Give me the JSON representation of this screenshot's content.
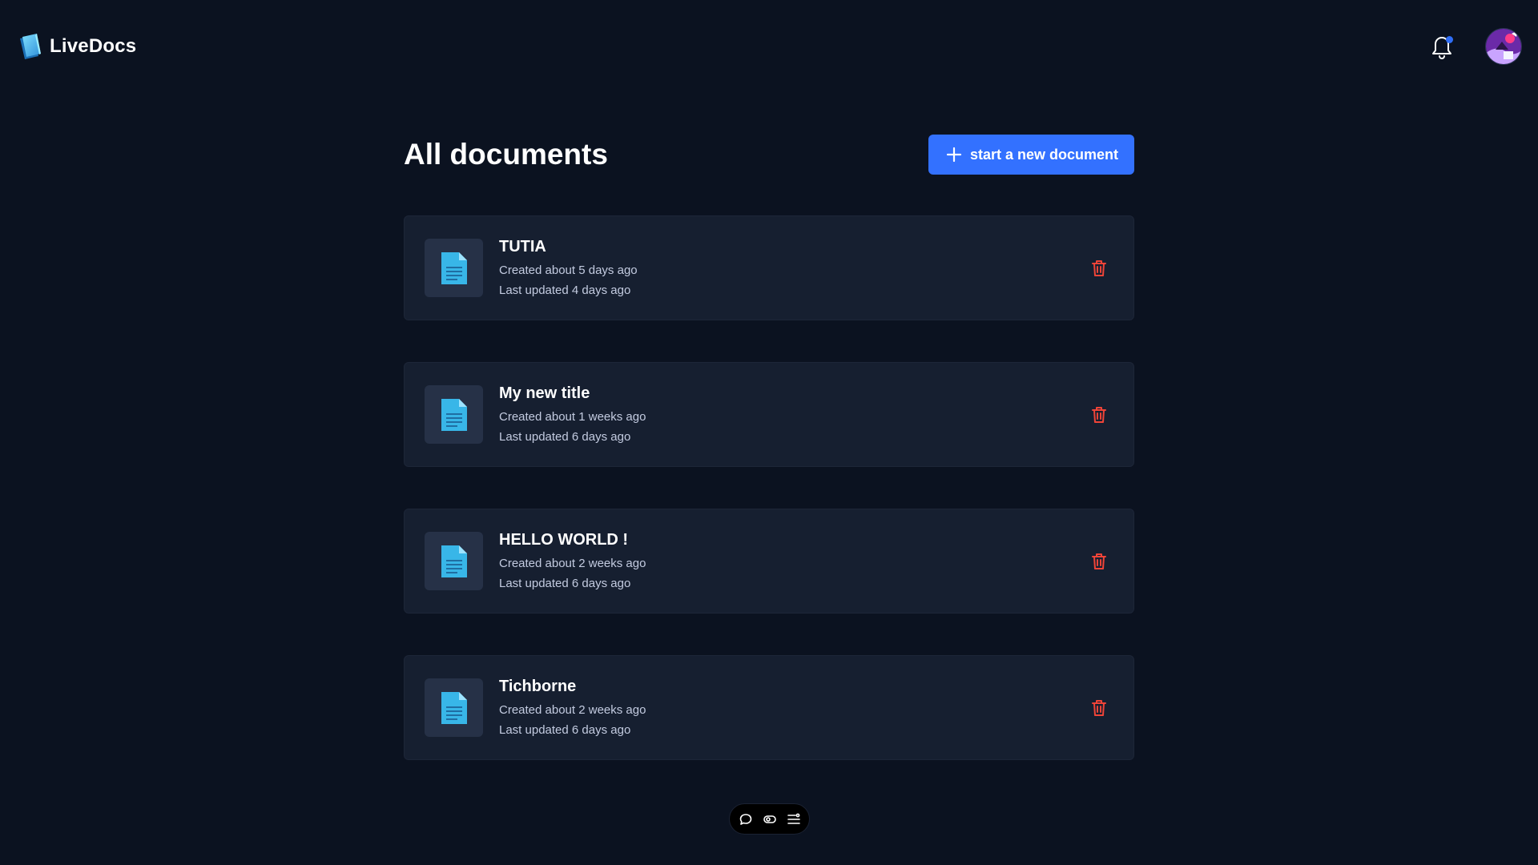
{
  "app": {
    "name": "LiveDocs"
  },
  "header": {
    "notifications_has_unread": true
  },
  "main": {
    "title": "All documents",
    "new_document_label": "start a new document"
  },
  "documents": [
    {
      "title": "TUTIA",
      "created": "Created about 5 days ago",
      "updated": "Last updated 4 days ago"
    },
    {
      "title": "My new title",
      "created": "Created about 1 weeks ago",
      "updated": "Last updated 6 days ago"
    },
    {
      "title": "HELLO WORLD !",
      "created": "Created about 2 weeks ago",
      "updated": "Last updated 6 days ago"
    },
    {
      "title": "Tichborne",
      "created": "Created about 2 weeks ago",
      "updated": "Last updated 6 days ago"
    }
  ],
  "toolbar": {
    "icons": [
      "chat-bubble-icon",
      "toggle-icon",
      "list-settings-icon"
    ]
  },
  "colors": {
    "background": "#0b1220",
    "card": "#161f30",
    "accent": "#3371ff",
    "danger": "#f04438",
    "document_icon": "#38b6e8"
  }
}
